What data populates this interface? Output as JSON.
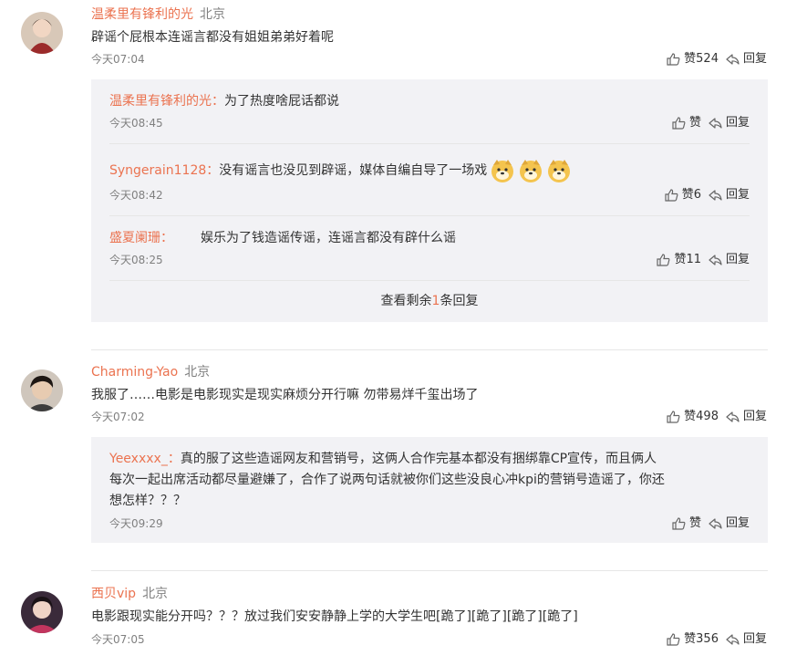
{
  "colors": {
    "username": "#eb7350",
    "muted": "#808080",
    "text": "#333333",
    "reply_bg": "#f2f2f5"
  },
  "comments": [
    {
      "username": "温柔里有锋利的光",
      "location": "北京",
      "text": "辟谣个屁根本连谣言都没有姐姐弟弟好着呢",
      "time": "今天07:04",
      "like_label": "赞524",
      "reply_label": "回复",
      "replies": [
        {
          "username": "温柔里有锋利的光：",
          "text": "为了热度啥屁话都说",
          "time": "今天08:45",
          "like_label": "赞",
          "reply_label": "回复"
        },
        {
          "username": "Syngerain1128：",
          "text": "没有谣言也没见到辟谣，媒体自编自导了一场戏",
          "emoji": "doge-emoji",
          "time": "今天08:42",
          "like_label": "赞6",
          "reply_label": "回复"
        },
        {
          "username": "盛夏阑珊：",
          "text": "娱乐为了钱造谣传谣，连谣言都没有辟什么谣",
          "time": "今天08:25",
          "like_label": "赞11",
          "reply_label": "回复"
        }
      ],
      "more": {
        "prefix": "查看剩余",
        "count": "1",
        "suffix": "条回复"
      }
    },
    {
      "username": "Charming-Yao",
      "location": "北京",
      "text": "我服了……电影是电影现实是现实麻烦分开行嘛 勿带易烊千玺出场了",
      "time": "今天07:02",
      "like_label": "赞498",
      "reply_label": "回复",
      "replies": [
        {
          "username": "Yeexxxx_：",
          "text_lines": [
            "真的服了这些造谣网友和营销号，这俩人合作完基本都没有捆绑靠CP宣传，而且俩人",
            "每次一起出席活动都尽量避嫌了，合作了说两句话就被你们这些没良心冲kpi的营销号造谣了，你还",
            "想怎样？？？"
          ],
          "time": "今天09:29",
          "like_label": "赞",
          "reply_label": "回复"
        }
      ]
    },
    {
      "username": "西贝vip",
      "location": "北京",
      "text": "电影跟现实能分开吗？？？放过我们安安静静上学的大学生吧[跪了][跪了][跪了][跪了]",
      "time": "今天07:05",
      "like_label": "赞356",
      "reply_label": "回复"
    }
  ]
}
